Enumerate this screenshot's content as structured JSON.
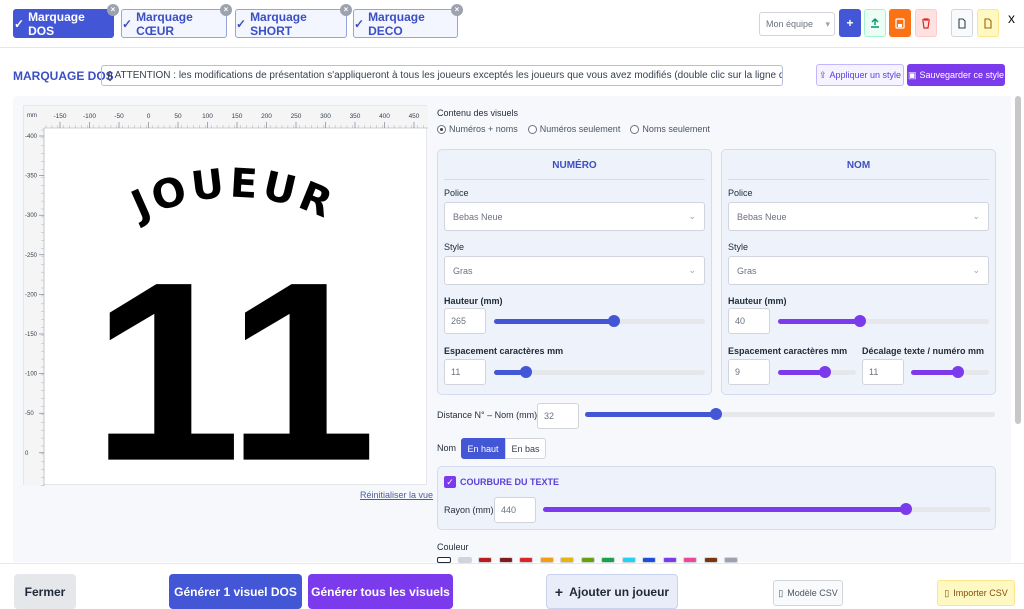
{
  "tabs": [
    {
      "label": "Marquage DOS",
      "check": "✓",
      "active": true
    },
    {
      "label": "Marquage CŒUR",
      "check": "✓",
      "active": false
    },
    {
      "label": "Marquage SHORT",
      "check": "✓",
      "active": false
    },
    {
      "label": "Marquage DECO",
      "check": "✓",
      "active": false
    }
  ],
  "toolbar": {
    "team_select": "Mon équipe",
    "close": "x"
  },
  "section": {
    "title": "MARQUAGE DOS",
    "attention": "ATTENTION : les modifications de présentation s'appliqueront à tous les joueurs exceptés les joueurs que vous avez modifiés (double clic sur la ligne du joueur)",
    "apply_style": "Appliquer un style",
    "save_style": "Sauvegarder ce style"
  },
  "preview": {
    "unit": "mm",
    "x_ticks": [
      "-150",
      "-100",
      "-50",
      "0",
      "50",
      "100",
      "150",
      "200",
      "250",
      "300",
      "350",
      "400",
      "450"
    ],
    "y_ticks": [
      "-400",
      "-350",
      "-300",
      "-250",
      "-200",
      "-150",
      "-100",
      "-50",
      "0"
    ],
    "name": "JOUEUR",
    "number": "11",
    "reset_link": "Réinitialiser la vue"
  },
  "content": {
    "label": "Contenu des visuels",
    "options": [
      "Numéros + noms",
      "Numéros seulement",
      "Noms seulement"
    ],
    "selected": 0
  },
  "numero": {
    "title": "NUMÉRO",
    "police_label": "Police",
    "police_value": "Bebas Neue",
    "style_label": "Style",
    "style_value": "Gras",
    "height_label": "Hauteur (mm)",
    "height_value": "265",
    "height_level": 0.57,
    "spacing_label": "Espacement caractères mm",
    "spacing_value": "11",
    "spacing_level": 0.15
  },
  "nom": {
    "title": "NOM",
    "police_label": "Police",
    "police_value": "Bebas Neue",
    "style_label": "Style",
    "style_value": "Gras",
    "height_label": "Hauteur (mm)",
    "height_value": "40",
    "height_level": 0.39,
    "spacing_label": "Espacement caractères mm",
    "spacing_value": "9",
    "spacing_level": 0.6,
    "offset_label": "Décalage texte / numéro mm",
    "offset_value": "11",
    "offset_level": 0.6
  },
  "distance": {
    "label": "Distance N° – Nom (mm)",
    "value": "32",
    "level": 0.32
  },
  "position": {
    "label": "Nom",
    "options": [
      "En haut",
      "En bas"
    ],
    "selected": 0
  },
  "curvature": {
    "label": "COURBURE DU TEXTE",
    "checked": true,
    "radius_label": "Rayon (mm)",
    "radius_value": "440",
    "radius_level": 0.81
  },
  "color": {
    "label": "Couleur",
    "swatches": [
      "#ffffff",
      "#d1d5db",
      "#b91c1c",
      "#7f1d1d",
      "#dc2626",
      "#f59e0b",
      "#eab308",
      "#65a30d",
      "#16a34a",
      "#22d3ee",
      "#1d4ed8",
      "#7c3aed",
      "#ec4899",
      "#78350f",
      "#9ca3af"
    ]
  },
  "footer": {
    "close": "Fermer",
    "generate_one": "Générer 1 visuel DOS",
    "generate_all": "Générer tous les visuels",
    "add_player": "Ajouter un joueur",
    "csv_model": "Modèle CSV",
    "import_csv": "Importer CSV"
  },
  "colors": {
    "primary": "#4256d6",
    "purple": "#7c3aed",
    "orange": "#f97316"
  }
}
